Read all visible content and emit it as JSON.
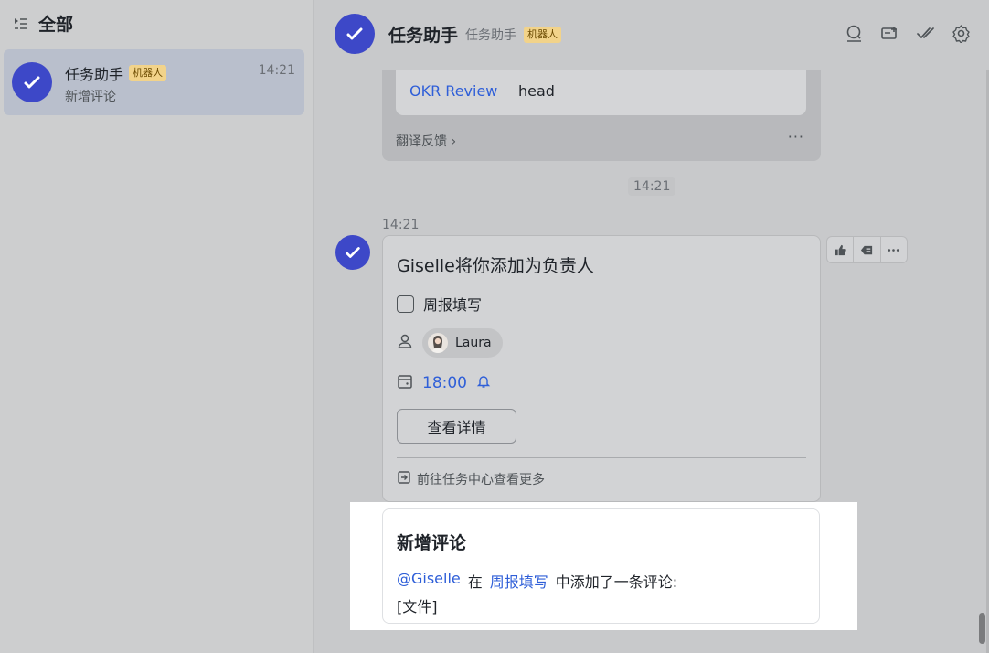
{
  "sidebar": {
    "title": "全部",
    "chat": {
      "name": "任务助手",
      "badge": "机器人",
      "time": "14:21",
      "preview": "新增评论"
    }
  },
  "header": {
    "name": "任务助手",
    "subtitle": "任务助手",
    "badge": "机器人",
    "actions": [
      "search-icon",
      "add-card-icon",
      "task-check-icon",
      "gear-icon"
    ]
  },
  "previous_message": {
    "link": "OKR Review",
    "text": "head",
    "feedback": "翻译反馈",
    "more": "···"
  },
  "time_divider": "14:21",
  "task_message": {
    "time": "14:21",
    "title": "Giselle将你添加为负责人",
    "task_name": "周报填写",
    "assignee": "Laura",
    "due": "18:00",
    "detail_button": "查看详情",
    "task_center": "前往任务中心查看更多"
  },
  "comment_message": {
    "title": "新增评论",
    "mention": "@Giselle",
    "in_word": "在",
    "task_link": "周报填写",
    "suffix": "中添加了一条评论:",
    "content": "[文件]"
  },
  "colors": {
    "brand_avatar": "#3d48c8",
    "link": "#2f5fd8",
    "badge_bg": "#f2d38a"
  }
}
